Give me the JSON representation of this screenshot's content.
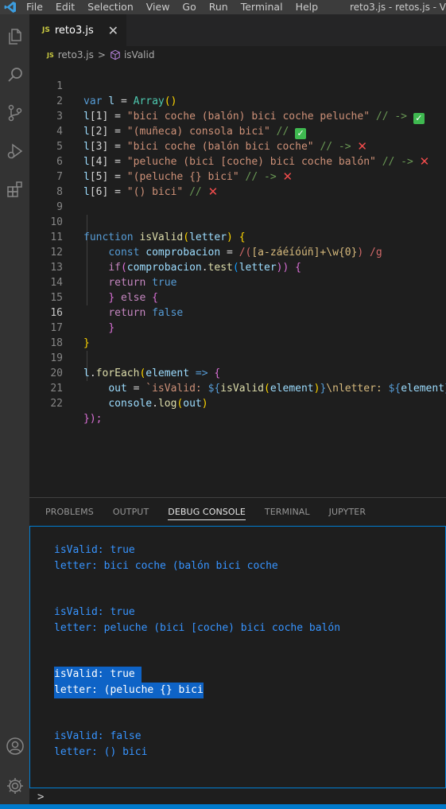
{
  "menubar": {
    "items": [
      "File",
      "Edit",
      "Selection",
      "View",
      "Go",
      "Run",
      "Terminal",
      "Help"
    ],
    "window_title": "reto3.js - retos.js - V"
  },
  "tab": {
    "badge": "JS",
    "filename": "reto3.js",
    "close": "✕"
  },
  "breadcrumb": {
    "badge": "JS",
    "file": "reto3.js",
    "separator": ">",
    "symbol": "isValid"
  },
  "editor": {
    "current_line": 16,
    "line_numbers": [
      "1",
      "2",
      "3",
      "4",
      "5",
      "6",
      "7",
      "8",
      "9",
      "10",
      "11",
      "12",
      "13",
      "14",
      "15",
      "16",
      "17",
      "18",
      "19",
      "20",
      "21",
      "22"
    ],
    "lines": {
      "l1": {
        "kw": "var",
        "v": "l",
        "eq": " = ",
        "cls": "Array",
        "paren": "()"
      },
      "l2": {
        "v": "l",
        "idx": "[1]",
        "eq": " = ",
        "str": "\"bici coche (balón) bici coche peluche\"",
        "cmt": "// ->"
      },
      "l3": {
        "v": "l",
        "idx": "[2]",
        "eq": " = ",
        "str": "\"(muñeca) consola bici\"",
        "cmt": "//"
      },
      "l4": {
        "v": "l",
        "idx": "[3]",
        "eq": " = ",
        "str": "\"bici coche (balón bici coche\"",
        "cmt": "// ->"
      },
      "l5": {
        "v": "l",
        "idx": "[4]",
        "eq": " = ",
        "str": "\"peluche (bici [coche) bici coche balón\"",
        "cmt": "// ->"
      },
      "l6": {
        "v": "l",
        "idx": "[5]",
        "eq": " = ",
        "str": "\"(peluche {} bici\"",
        "cmt": "// ->"
      },
      "l7": {
        "v": "l",
        "idx": "[6]",
        "eq": " = ",
        "str": "\"() bici\"",
        "cmt": "//"
      },
      "l10": {
        "kw": "function",
        "fn": "isValid",
        "p1": "(",
        "param": "letter",
        "p2": ")",
        "b": "{"
      },
      "l11": {
        "kw": "const",
        "v": "comprobacion",
        "eq": " = ",
        "rx1": "/(",
        "rxc1": "[a-záéíóúñ]+\\w{0}",
        "rx2": ") /g"
      },
      "l12": {
        "kw": "if",
        "p1": "(",
        "v": "comprobacion",
        "dot": ".",
        "fn": "test",
        "p2": "(",
        "param": "letter",
        "p3": "))",
        "b": "{"
      },
      "l13": {
        "kw": "return",
        "val": "true"
      },
      "l14": {
        "b": "}",
        "kw": "else",
        "b2": "{"
      },
      "l15": {
        "kw": "return",
        "val": "false"
      },
      "l16": {
        "b": "}"
      },
      "l17": {
        "b": "}"
      },
      "l19": {
        "v": "l",
        "dot": ".",
        "fn": "forEach",
        "p1": "(",
        "param": "element",
        "arrow": " => ",
        "b": "{"
      },
      "l20": {
        "v": "out",
        "eq": " = ",
        "s1": "`isValid: ",
        "t1": "${",
        "fn": "isValid",
        "p1": "(",
        "param": "element",
        "p2": ")",
        "t2": "}",
        "s2": "\\nletter: ",
        "t3": "${",
        "param2": "element",
        "t4": "}"
      },
      "l21": {
        "v": "console",
        "dot": ".",
        "fn": "log",
        "p1": "(",
        "param": "out",
        "p2": ")"
      },
      "l22": {
        "b": "});"
      }
    }
  },
  "panel": {
    "tabs": [
      "PROBLEMS",
      "OUTPUT",
      "DEBUG CONSOLE",
      "TERMINAL",
      "JUPYTER"
    ],
    "active_tab": "DEBUG CONSOLE",
    "console_lines": [
      "isValid: true",
      "letter: bici coche (balón bici coche",
      "isValid: true",
      "letter: peluche (bici [coche) bici coche balón",
      "isValid: true ",
      "letter: (peluche {} bici",
      "isValid: false",
      "letter: () bici"
    ],
    "prompt": ">"
  },
  "colors": {
    "accent": "#007acc",
    "selection": "#0e63c6",
    "console_text": "#3794ff"
  },
  "icons": [
    "vscode-logo-icon",
    "explorer-icon",
    "search-icon",
    "source-control-icon",
    "run-debug-icon",
    "extensions-icon",
    "account-icon",
    "settings-gear-icon",
    "check-icon",
    "cross-icon",
    "cube-icon"
  ]
}
